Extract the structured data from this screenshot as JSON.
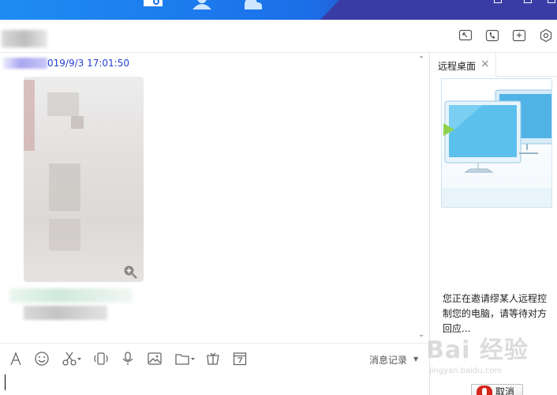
{
  "chat": {
    "timestamp": "019/9/3 17:01:50"
  },
  "toolbar": {
    "history_label": "消息记录",
    "tools": [
      "font-icon",
      "emoji-icon",
      "scissors-icon",
      "shake-icon",
      "microphone-icon",
      "image-icon",
      "folder-icon",
      "gift-icon",
      "calendar-icon"
    ]
  },
  "remote_desktop": {
    "tab_label": "远程桌面",
    "tab_close": "×",
    "invite_text": "您正在邀请缪某人远程控制您的电脑，请等待对方回应...",
    "cancel_label": "取消"
  },
  "watermark": {
    "text": "Bai 经验",
    "sub": "jingyan.baidu.com"
  },
  "colors": {
    "topbar": "#1b6fe8",
    "timestamp": "#2740d8",
    "cancel_icon": "#d4261c"
  }
}
